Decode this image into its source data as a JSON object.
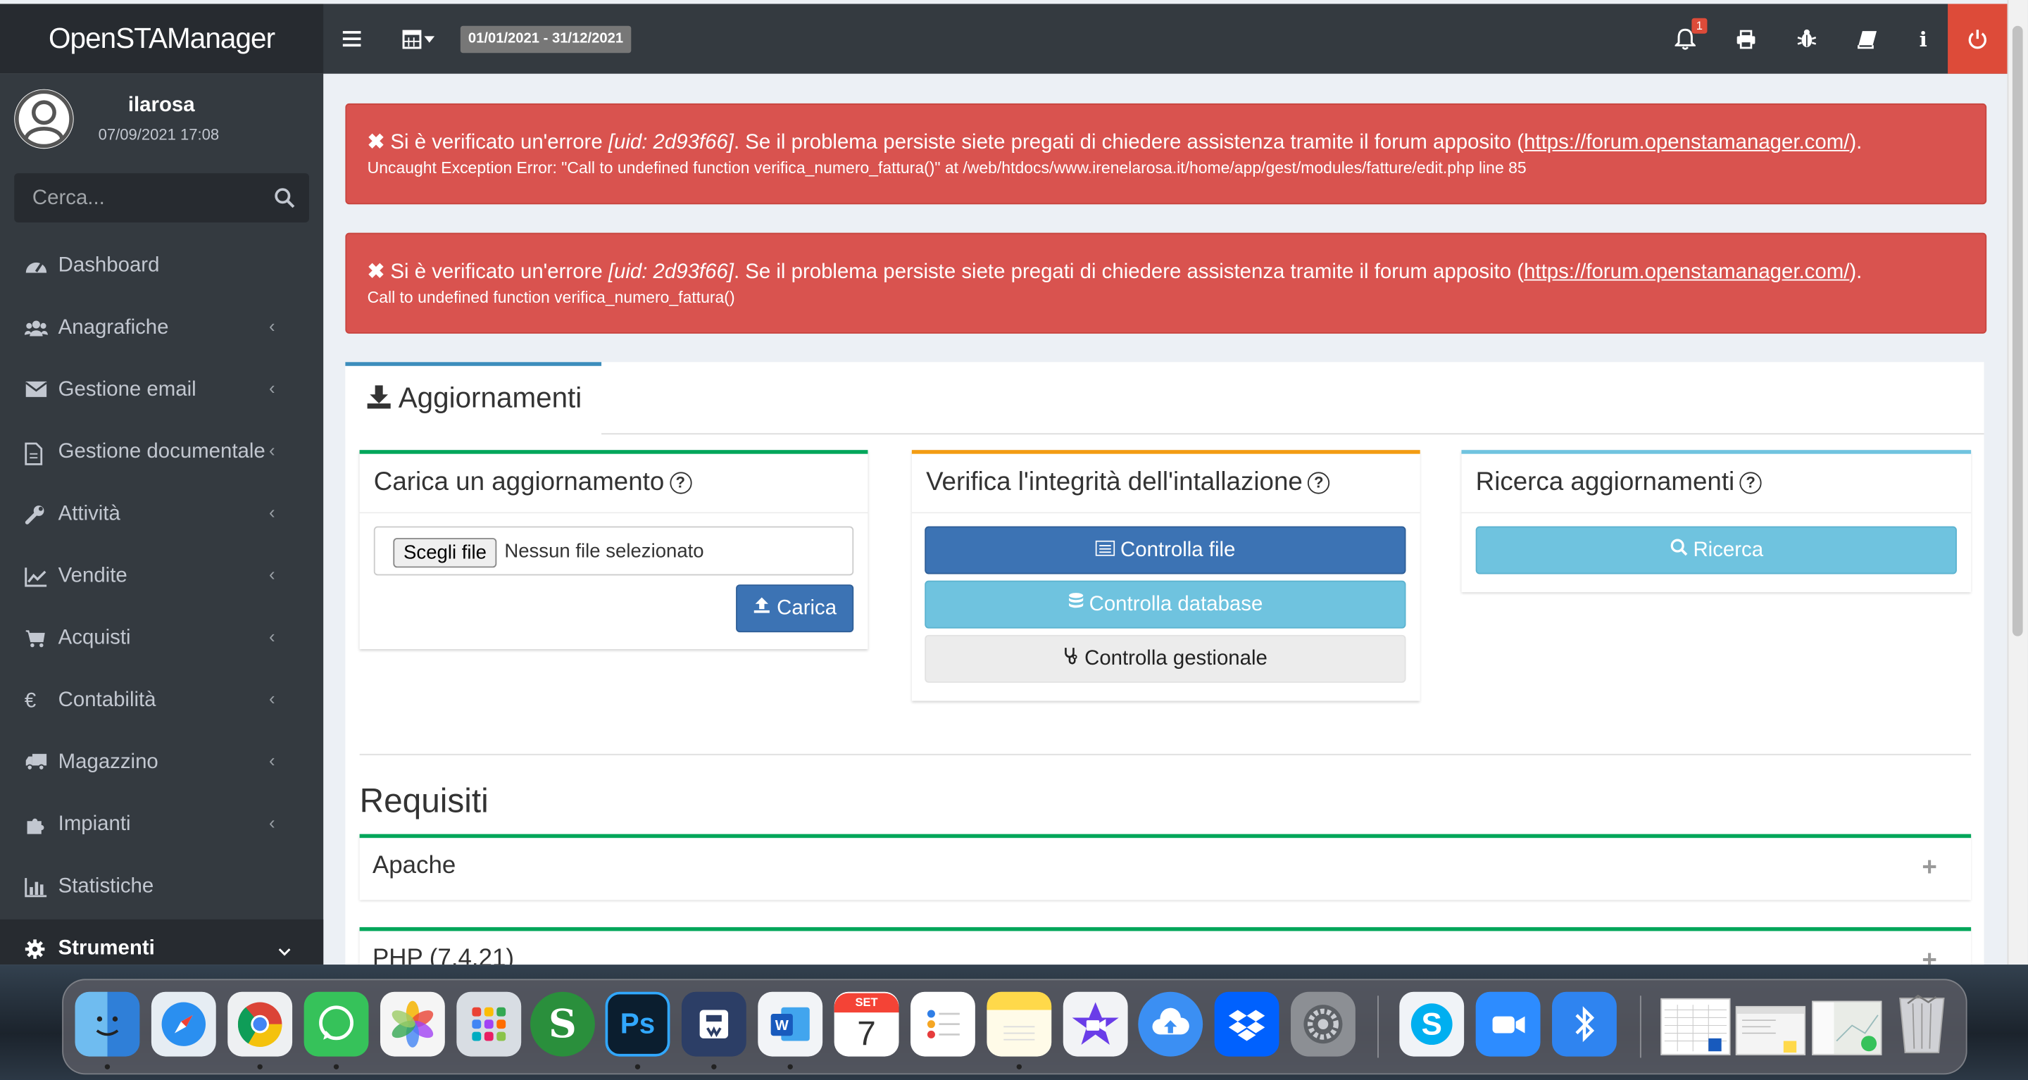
{
  "app": {
    "title": "OpenSTAManager"
  },
  "header": {
    "date_range": "01/01/2021 - 31/12/2021",
    "notification_count": "1"
  },
  "user": {
    "name": "ilarosa",
    "datetime": "07/09/2021 17:08"
  },
  "search": {
    "placeholder": "Cerca..."
  },
  "sidebar": {
    "items": [
      {
        "label": "Dashboard",
        "icon": "dashboard-icon"
      },
      {
        "label": "Anagrafiche",
        "icon": "users-icon"
      },
      {
        "label": "Gestione email",
        "icon": "envelope-icon"
      },
      {
        "label": "Gestione documentale",
        "icon": "document-icon"
      },
      {
        "label": "Attività",
        "icon": "wrench-icon"
      },
      {
        "label": "Vendite",
        "icon": "line-chart-icon"
      },
      {
        "label": "Acquisti",
        "icon": "cart-icon"
      },
      {
        "label": "Contabilità",
        "icon": "euro-icon"
      },
      {
        "label": "Magazzino",
        "icon": "truck-icon"
      },
      {
        "label": "Impianti",
        "icon": "puzzle-icon"
      },
      {
        "label": "Statistiche",
        "icon": "bar-chart-icon"
      },
      {
        "label": "Strumenti",
        "icon": "gear-icon"
      }
    ]
  },
  "alerts": [
    {
      "prefix": "Si è verificato un'errore ",
      "uid": "[uid: 2d93f66]",
      "middle": ". Se il problema persiste siete pregati di chiedere assistenza tramite il forum apposito (",
      "link": "https://forum.openstamanager.com/",
      "suffix": ").",
      "detail": "Uncaught Exception Error: \"Call to undefined function verifica_numero_fattura()\" at /web/htdocs/www.irenelarosa.it/home/app/gest/modules/fatture/edit.php line 85"
    },
    {
      "prefix": "Si è verificato un'errore ",
      "uid": "[uid: 2d93f66]",
      "middle": ". Se il problema persiste siete pregati di chiedere assistenza tramite il forum apposito (",
      "link": "https://forum.openstamanager.com/",
      "suffix": ").",
      "detail": "Call to undefined function verifica_numero_fattura()"
    }
  ],
  "main": {
    "tab_title": "Aggiornamenti",
    "cards": {
      "upload": {
        "title": "Carica un aggiornamento",
        "file_button": "Scegli file",
        "file_status": "Nessun file selezionato",
        "submit": "Carica"
      },
      "integrity": {
        "title": "Verifica l'integrità dell'intallazione",
        "check_files": "Controlla file",
        "check_db": "Controlla database",
        "check_app": "Controlla gestionale"
      },
      "search": {
        "title": "Ricerca aggiornamenti",
        "button": "Ricerca"
      }
    },
    "requirements": {
      "title": "Requisiti",
      "items": [
        {
          "label": "Apache"
        },
        {
          "label": "PHP (7.4.21)"
        }
      ]
    }
  },
  "dock": {
    "calendar": {
      "month": "SET",
      "day": "7"
    },
    "apps": [
      "Finder",
      "Safari",
      "Chrome",
      "WhatsApp",
      "Photos",
      "Launchpad",
      "Sublime",
      "Photoshop",
      "Wunderbucket",
      "Word",
      "Calendar",
      "Reminders",
      "Notes",
      "iMovie",
      "Cloud Upload",
      "Dropbox",
      "System Preferences",
      "Skype",
      "Zoom",
      "Bluetooth",
      "Trash"
    ]
  },
  "colors": {
    "danger": "#d9534f",
    "primary": "#3c73b4",
    "info": "#6fc3df",
    "success": "#00a65a",
    "warning": "#f39c12",
    "sidebar": "#343a40"
  }
}
